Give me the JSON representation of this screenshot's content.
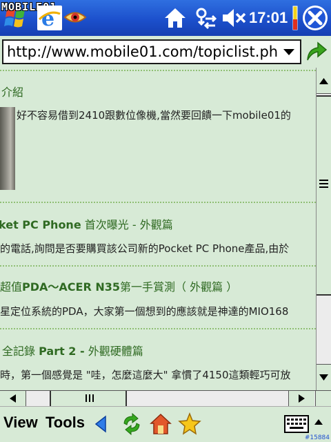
{
  "titlebar": {
    "watermark": "MOBILE01",
    "clock": "17:01"
  },
  "address": {
    "url": "http://www.mobile01.com/topiclist.ph"
  },
  "content": {
    "items": [
      {
        "heading": "介紹",
        "body": "好不容易借到2410跟數位像機,當然要回饋一下mobile01的"
      },
      {
        "heading_bold": "ket PC Phone",
        "heading_rest": " 首次曝光 - 外觀篇",
        "body": "的電話,詢問是否要購買該公司新的Pocket PC Phone產品,由於"
      },
      {
        "heading_pre": "超值",
        "heading_bold": "PDA～ACER N35",
        "heading_rest": "第一手賞測（ 外觀篇 ）",
        "body": "星定位系統的PDA，大家第一個想到的應該就是神達的MIO168"
      },
      {
        "heading_pre": "全記錄 ",
        "heading_bold": "Part 2 -",
        "heading_rest": " 外觀硬體篇",
        "body": "時，第一個感覺是 \"哇，怎麼這麼大\" 拿慣了4150這類輕巧可放"
      }
    ]
  },
  "menubar": {
    "view_label": "View",
    "tools_label": "Tools",
    "corner_tag": "#15884"
  },
  "icons": {
    "start": "windows-flag-icon",
    "ie": "internet-explorer-icon",
    "eye": "eye-icon",
    "home": "home-icon",
    "connectivity": "connectivity-icon",
    "volume": "volume-muted-icon",
    "battery": "battery-icon",
    "close": "close-icon",
    "go": "go-arrow-icon",
    "back": "back-arrow-icon",
    "refresh": "refresh-icon",
    "home_tb": "home-toolbar-icon",
    "favorites": "favorites-star-icon",
    "keyboard": "keyboard-icon"
  },
  "colors": {
    "titlebar": "#1c50cc",
    "content_bg": "#d7ead6",
    "heading": "#2f6a22",
    "divider": "#8fbf74"
  }
}
